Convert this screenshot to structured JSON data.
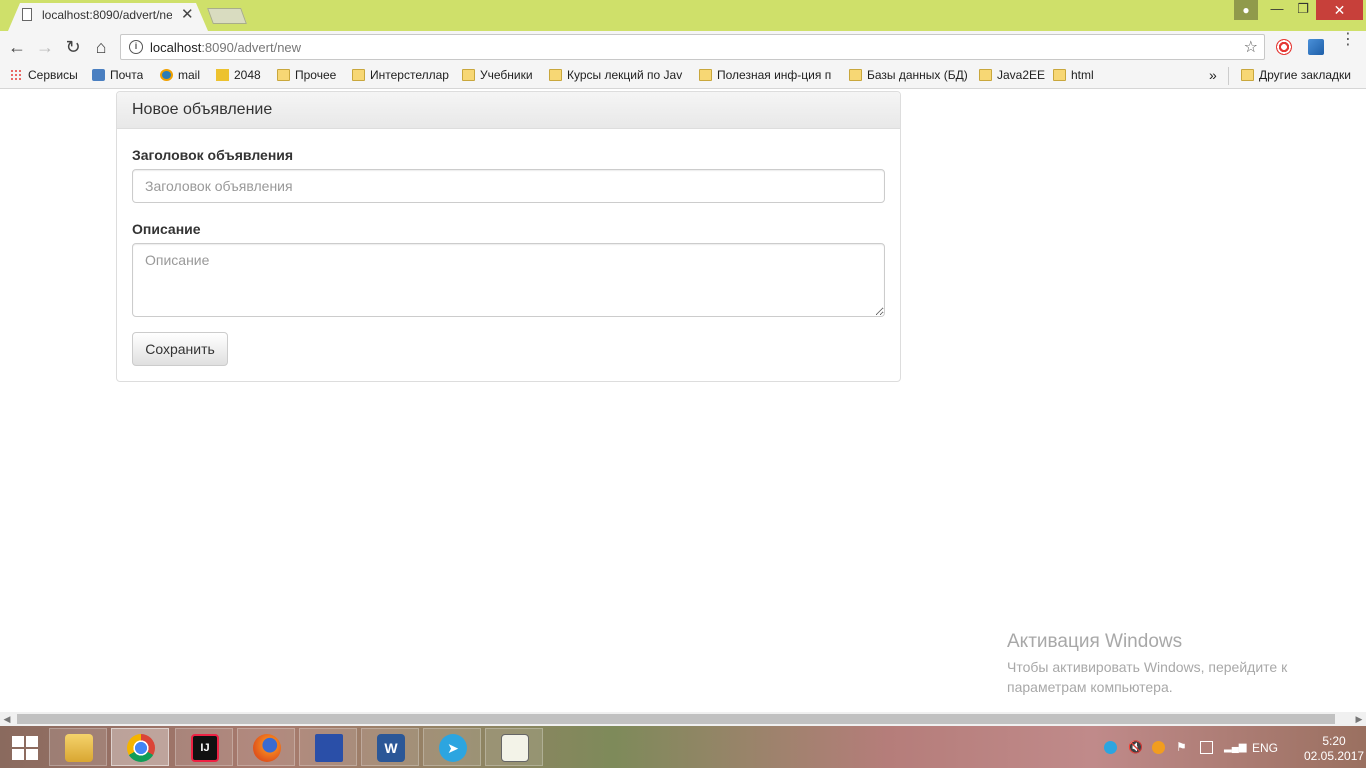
{
  "browser": {
    "tab_title": "localhost:8090/advert/ne",
    "tab_close": "✕",
    "address": {
      "host": "localhost",
      "rest": ":8090/advert/new"
    },
    "bookmarks": [
      {
        "label": "Сервисы",
        "icon": "apps-grid-icon"
      },
      {
        "label": "Почта",
        "icon": "mail-icon"
      },
      {
        "label": "mail",
        "icon": "mailru-icon"
      },
      {
        "label": "2048",
        "icon": "game-2048-icon"
      },
      {
        "label": "Прочее",
        "icon": "folder-icon"
      },
      {
        "label": "Интерстеллар",
        "icon": "folder-icon"
      },
      {
        "label": "Учебники",
        "icon": "folder-icon"
      },
      {
        "label": "Курсы лекций по Jav",
        "icon": "folder-icon"
      },
      {
        "label": "Полезная инф-ция п",
        "icon": "folder-icon"
      },
      {
        "label": "Базы данных (БД)",
        "icon": "folder-icon"
      },
      {
        "label": "Java2EE",
        "icon": "folder-icon"
      },
      {
        "label": "html",
        "icon": "folder-icon"
      }
    ],
    "bookmarks_more": "»",
    "other_bookmarks": "Другие закладки"
  },
  "form": {
    "panel_title": "Новое объявление",
    "title_label": "Заголовок объявления",
    "title_placeholder": "Заголовок объявления",
    "description_label": "Описание",
    "description_placeholder": "Описание",
    "save_label": "Сохранить"
  },
  "watermark": {
    "title": "Активация Windows",
    "text": "Чтобы активировать Windows, перейдите к параметрам компьютера."
  },
  "taskbar": {
    "lang": "ENG",
    "time": "5:20",
    "date": "02.05.2017",
    "apps": [
      "file-explorer-icon",
      "chrome-icon",
      "intellij-icon",
      "firefox-icon",
      "save-disk-icon",
      "word-icon",
      "telegram-icon",
      "notepad-icon"
    ]
  }
}
